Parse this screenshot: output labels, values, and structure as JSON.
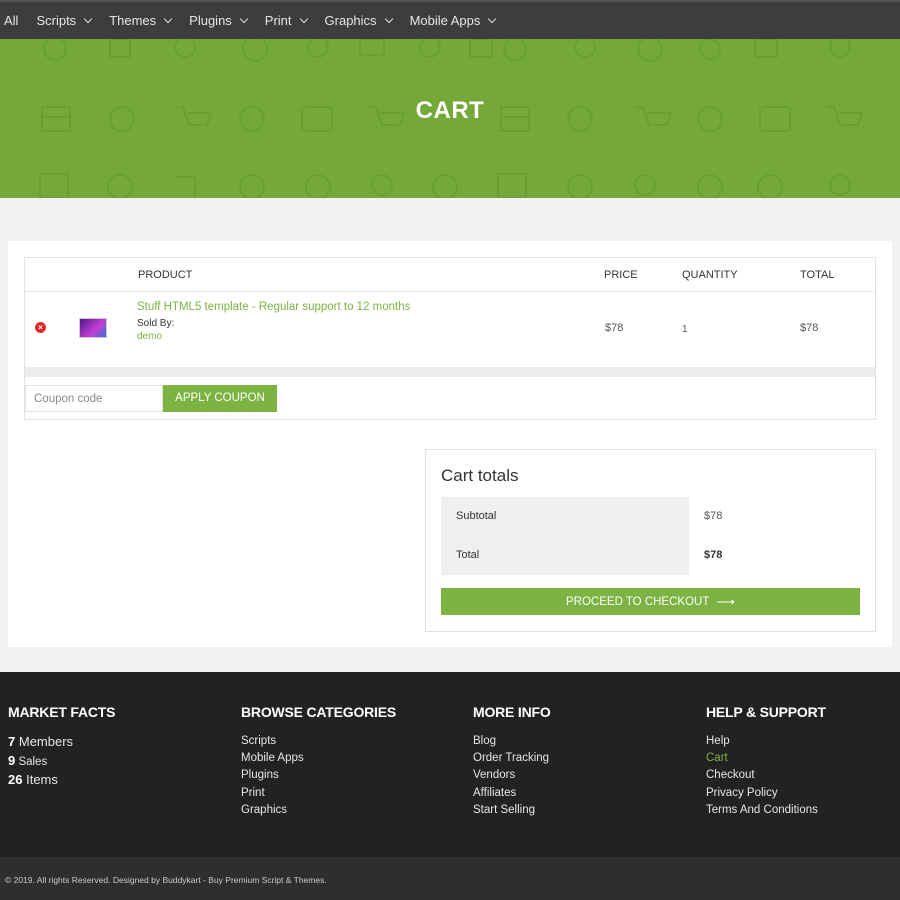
{
  "nav": {
    "items": [
      {
        "label": "All",
        "has_dropdown": false
      },
      {
        "label": "Scripts",
        "has_dropdown": true
      },
      {
        "label": "Themes",
        "has_dropdown": true
      },
      {
        "label": "Plugins",
        "has_dropdown": true
      },
      {
        "label": "Print",
        "has_dropdown": true
      },
      {
        "label": "Graphics",
        "has_dropdown": true
      },
      {
        "label": "Mobile Apps",
        "has_dropdown": true
      }
    ]
  },
  "banner": {
    "title": "CART",
    "color": "#74a93a"
  },
  "cart": {
    "columns": [
      "PRODUCT",
      "PRICE",
      "QUANTITY",
      "TOTAL"
    ],
    "items": [
      {
        "remove_icon": "remove-circle-icon",
        "name": "Stuff HTML5 template - Regular support to 12 months",
        "sold_by_label": "Sold By:",
        "vendor": "demo",
        "price": "$78",
        "quantity": "1",
        "total": "$78"
      }
    ],
    "coupon_placeholder": "Coupon code",
    "apply_label": "APPLY COUPON"
  },
  "totals": {
    "title": "Cart totals",
    "subtotal_label": "Subtotal",
    "subtotal_value": "$78",
    "total_label": "Total",
    "total_value": "$78",
    "checkout_label": "PROCEED TO CHECKOUT",
    "checkout_icon": "arrow-right-icon"
  },
  "footer": {
    "market_facts": {
      "heading": "MARKET FACTS",
      "facts": [
        {
          "count": "7",
          "label": "Members"
        },
        {
          "count": "9",
          "label": "Sales"
        },
        {
          "count": "26",
          "label": "Items"
        }
      ]
    },
    "browse": {
      "heading": "BROWSE CATEGORIES",
      "links": [
        "Scripts",
        "Mobile Apps",
        "Plugins",
        "Print",
        "Graphics"
      ]
    },
    "more_info": {
      "heading": "MORE INFO",
      "links": [
        "Blog",
        "Order Tracking",
        "Vendors",
        "Affiliates",
        "Start Selling"
      ]
    },
    "help": {
      "heading": "HELP & SUPPORT",
      "links": [
        "Help",
        "Cart",
        "Checkout",
        "Privacy Policy",
        "Terms And Conditions"
      ],
      "active": "Cart"
    },
    "copyright": "© 2019. All rights Reserved. Designed by Buddykart - Buy Premium Script & Themes."
  },
  "colors": {
    "accent": "#7cb342",
    "nav_bg": "#3d3d3d",
    "footer_bg": "#222222"
  }
}
